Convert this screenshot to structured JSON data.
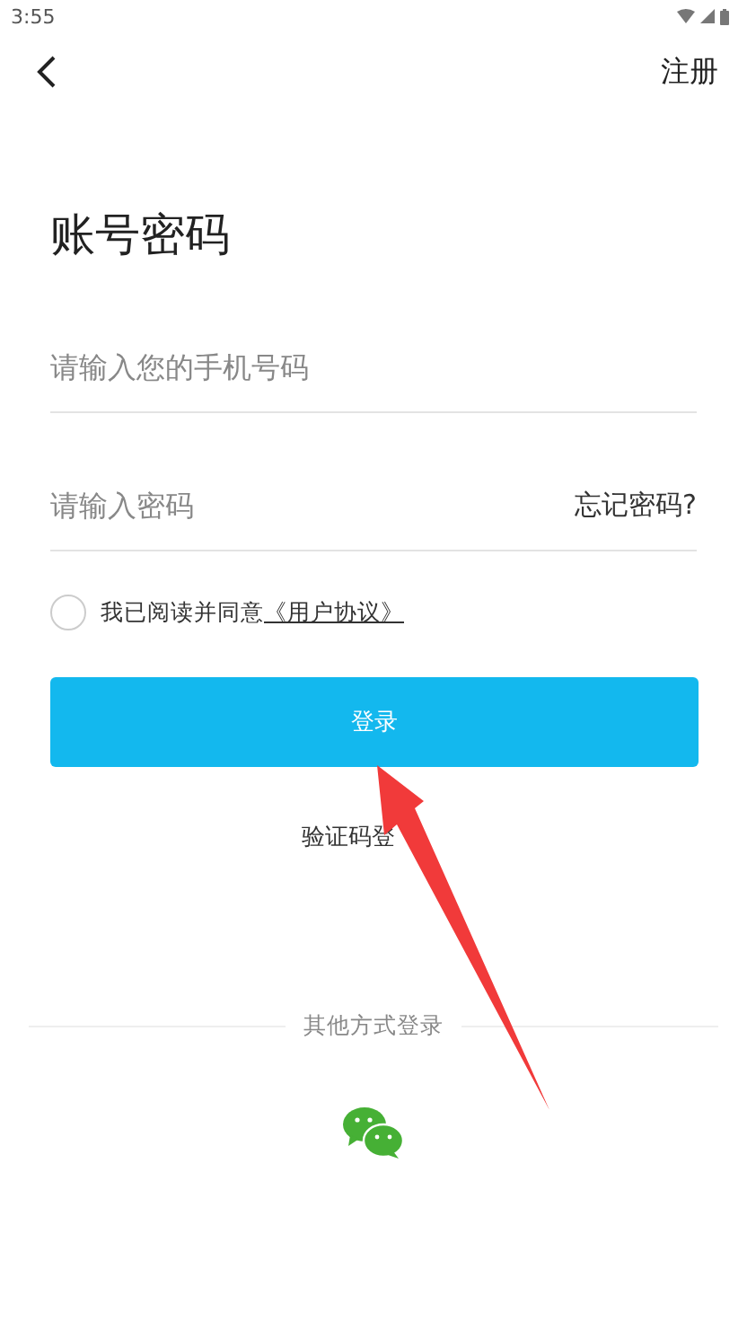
{
  "status_bar": {
    "time": "3:55"
  },
  "top_bar": {
    "action": "注册"
  },
  "title": "账号密码",
  "phone_field": {
    "placeholder": "请输入您的手机号码"
  },
  "password_field": {
    "placeholder": "请输入密码",
    "link": "忘记密码?"
  },
  "agreement": {
    "checked": false,
    "text": "我已阅读并同意",
    "link": "《用户协议》"
  },
  "login_button": "登录",
  "alt_link": "验证码登",
  "other_methods": {
    "label": "其他方式登录"
  },
  "annotation": {
    "kind": "arrow"
  }
}
